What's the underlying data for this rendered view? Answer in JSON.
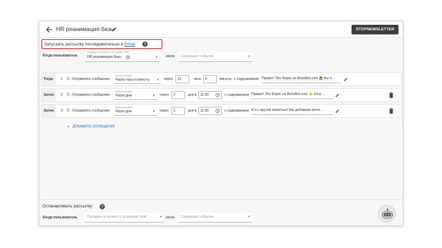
{
  "header": {
    "title": "HR реанимация базы",
    "stop_button": "STOPNEWSLETTER"
  },
  "launch": {
    "text": "Запускать рассылку последовательно в",
    "link": "Email"
  },
  "trigger": {
    "label": "Когда пользователь",
    "select_caption": "Попадает в сегмент с условием \"или\"",
    "select_value": "HR реанимация базы",
    "and_or": "и/или",
    "event_placeholder": "Совершает событие"
  },
  "steps": [
    {
      "tag": "Тогда",
      "index": "1",
      "action": "Отправлять сообщение",
      "time_caption": "Время отправки",
      "time_value": "Через часы и минуты",
      "through": "через",
      "amount1": "10",
      "unit1": "часа",
      "amount2": "0",
      "unit2": "минуты",
      "content_label": "с содержанием",
      "message": "Привет! Это Борис из BorisBot.com 🙇 Вы п...",
      "has_trash": false
    },
    {
      "tag": "Затем",
      "index": "2",
      "action": "Отправлять сообщение",
      "time_caption": "Время отправки",
      "time_value": "Через дни",
      "through": "через",
      "amount1": "2",
      "unit1": "дня в",
      "amount2": "11:00",
      "unit2": "",
      "content_label": "с содержанием",
      "message": "Привет! Это Борис из BorisBot.com 👋 Хочу ...",
      "has_trash": true
    },
    {
      "tag": "Затем",
      "index": "3",
      "action": "Отправлять сообщение",
      "time_caption": "Время отправки",
      "time_value": "Через дни",
      "through": "через",
      "amount1": "2",
      "unit1": "дня в",
      "amount2": "11:00",
      "unit2": "",
      "content_label": "с содержанием",
      "message": "И я с крутой новостью! Мы добавили интег...",
      "has_trash": true
    }
  ],
  "add_message": "ДОБАВИТЬ СООБЩЕНИЕ",
  "stop": {
    "title": "Останавливать рассылку",
    "label": "Когда пользователь",
    "segment_placeholder": "Попадает в сегмент с условием \"или\"",
    "and_or": "и/или",
    "event_placeholder": "Совершает событие"
  },
  "colors": {
    "accent": "#1e6fd9",
    "highlight_border": "#d32f2f",
    "dark_button": "#3d3d3d"
  }
}
